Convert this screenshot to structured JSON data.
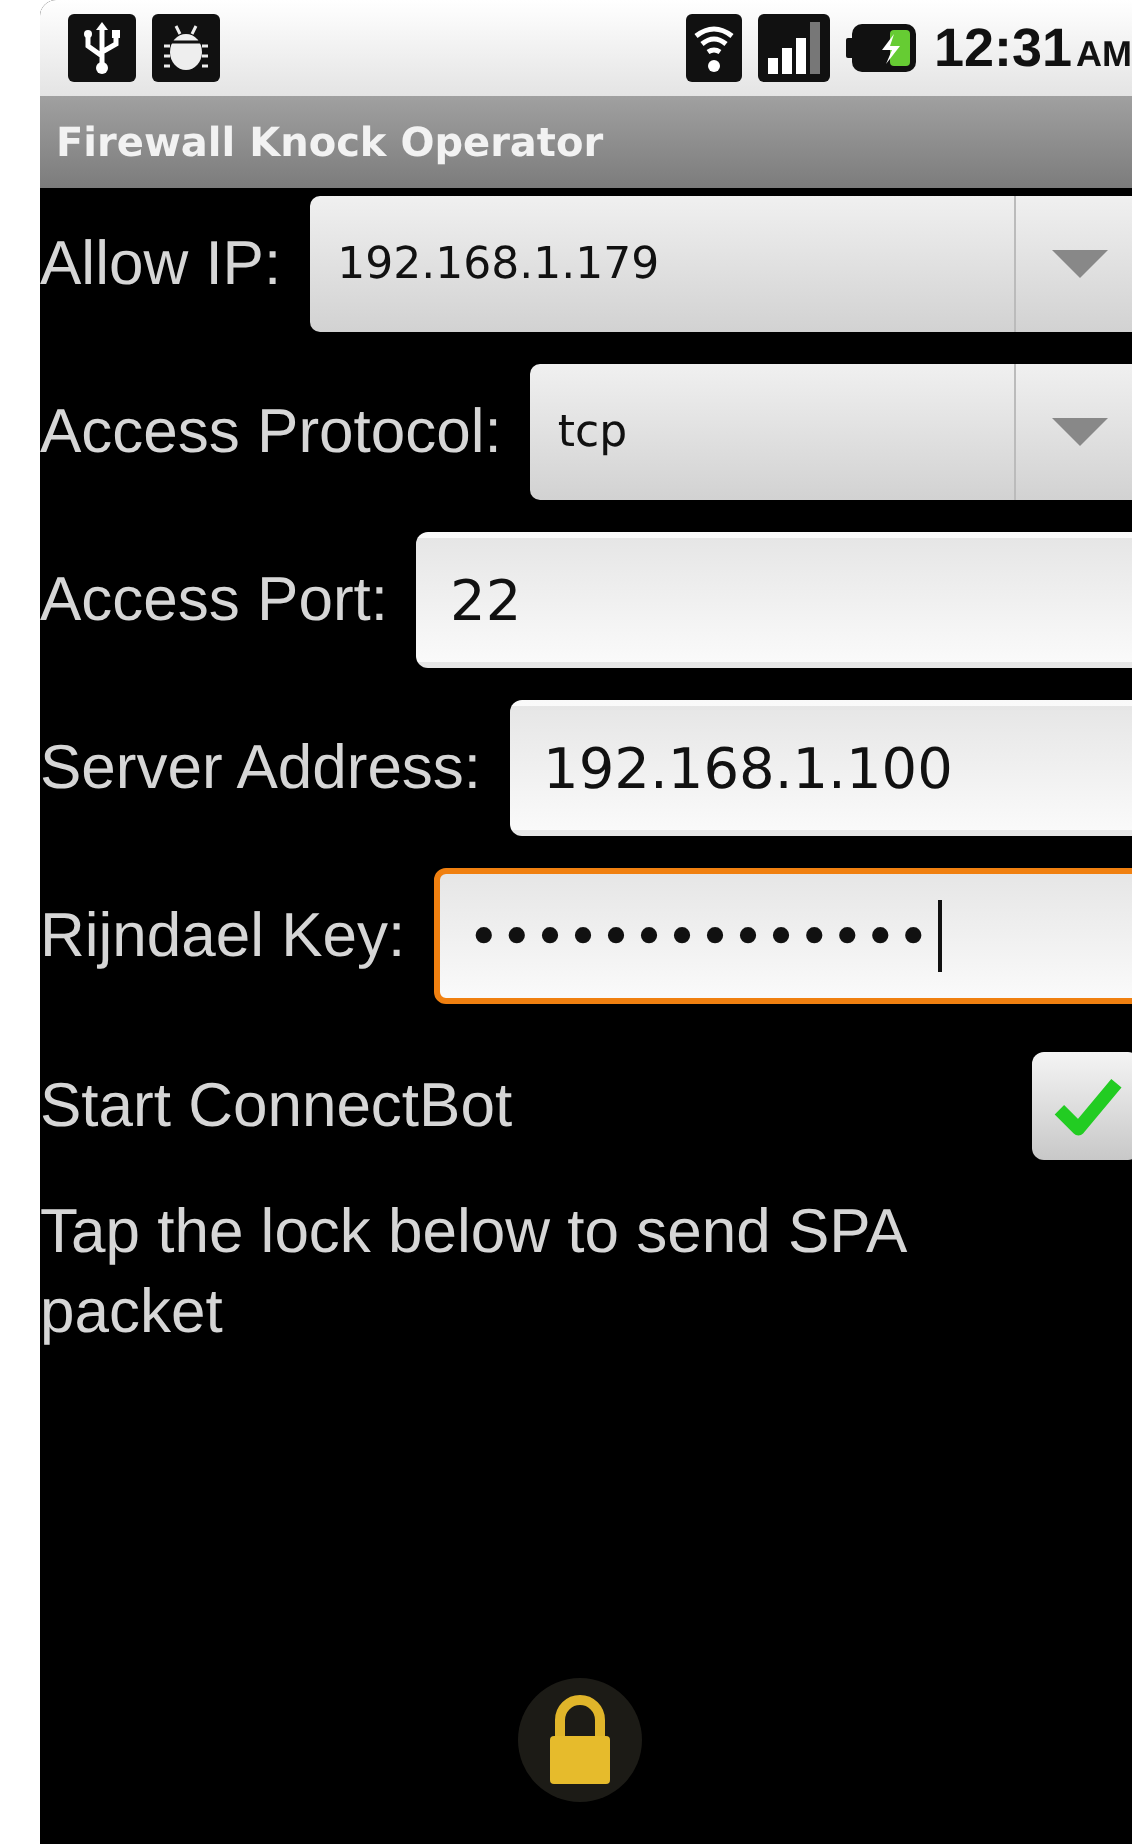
{
  "status_bar": {
    "time": "12:31",
    "meridiem": "AM"
  },
  "title": "Firewall Knock Operator",
  "form": [
    {
      "kind": "spinner",
      "label": "Allow IP:",
      "value": "192.168.1.179"
    },
    {
      "kind": "spinner",
      "label": "Access Protocol:",
      "value": "tcp"
    },
    {
      "kind": "text",
      "label": "Access Port:",
      "value": "22",
      "focused": false
    },
    {
      "kind": "text",
      "label": "Server Address:",
      "value": "192.168.1.100",
      "focused": false
    },
    {
      "kind": "text",
      "label": "Rijndael Key:",
      "value": "••••••••••••••",
      "focused": true
    }
  ],
  "connectbot": {
    "label": "Start ConnectBot",
    "checked": true
  },
  "hint": "Tap the lock below to send SPA packet"
}
